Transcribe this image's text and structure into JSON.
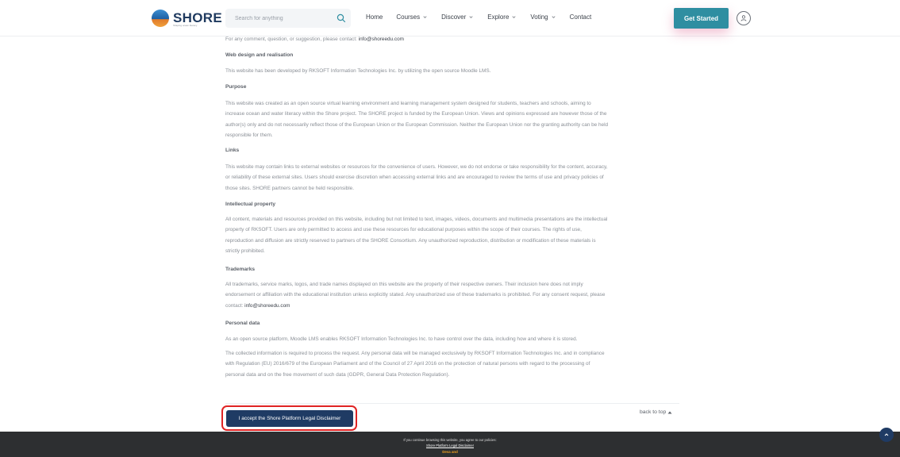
{
  "header": {
    "logo_text": "SHORE",
    "logo_subtitle": "Shaping ocean literacy",
    "search_placeholder": "Search for anything",
    "nav": [
      {
        "label": "Home",
        "has_dropdown": false
      },
      {
        "label": "Courses",
        "has_dropdown": true
      },
      {
        "label": "Discover",
        "has_dropdown": true
      },
      {
        "label": "Explore",
        "has_dropdown": true
      },
      {
        "label": "Voting",
        "has_dropdown": true
      },
      {
        "label": "Contact",
        "has_dropdown": false
      }
    ],
    "get_started_label": "Get Started",
    "accent_color": "#2f8ea1"
  },
  "content": {
    "contact_prefix": "For any comment, question, or suggestion, please contact: ",
    "contact_email": "info@shoreedu.com",
    "web_design_heading": "Web design and realisation",
    "web_design_text": "This website has been developed by RKSOFT Information Technologies Inc. by utilizing the open source Moodle LMS.",
    "purpose_heading": "Purpose",
    "purpose_lines": [
      "This website was created as an open source virtual learning environment and learning management system designed for students, teachers and schools, aiming to",
      "increase ocean and water literacy within the Shore project. The SHORE project is funded by the European Union. Views and opinions expressed are however those of the",
      "author(s) only and do not necessarily reflect those of the European Union or the European Commission. Neither the European Union nor the granting authority can be held",
      "responsible for them."
    ],
    "links_heading": "Links",
    "links_lines": [
      "This website may contain links to external websites or resources for the convenience of users. However, we do not endorse or take responsibility for the content, accuracy,",
      "or reliability of these external sites. Users should exercise discretion when accessing external links and are encouraged to review the terms of use and privacy policies of",
      "those sites. SHORE partners cannot be held responsible."
    ],
    "ip_heading": "Intellectual property",
    "ip_lines": [
      "All content, materials and resources provided on this website, including but not limited to text, images, videos, documents and multimedia presentations are the intellectual",
      "property of RKSOFT. Users are only permitted to access and use these resources for educational purposes within the scope of their courses. The rights of use,",
      "reproduction and diffusion are strictly reserved to partners of the SHORE Consortium.  Any unauthorized reproduction, distribution or modification of these materials is",
      "strictly prohibited."
    ],
    "trademarks_heading": "Trademarks",
    "trademarks_lines": [
      "All trademarks, service marks, logos, and trade names displayed on this website are the property of their respective owners. Their inclusion here does not imply",
      "endorsement or affiliation with the educational institution unless explicitly stated. Any unauthorized use of these trademarks is prohibited. For any consent request, please"
    ],
    "trademarks_contact_prefix": "contact: ",
    "trademarks_email": "info@shoreedu.com",
    "personal_heading": "Personal data",
    "personal_text": "As an open source platform, Moodle LMS enables RKSOFT Information Technologies Inc.  to have control over the data, including how and where it is stored.",
    "collected_lines": [
      "The collected information is required to process the request. Any personal data will be managed exclusively by RKSOFT Information Technologies Inc.  and in compliance",
      "with Regulation (EU) 2016/679 of the European Parliament and of the Council of 27 April 2016 on the protection of natural persons with regard to the processing of",
      "personal data and on the free movement of such data (GDPR, General Data Protection Regulation)."
    ]
  },
  "actions": {
    "accept_label": "I accept the Shore Platform Legal Disclaimer",
    "back_to_top_label": "back to top"
  },
  "footer": {
    "notice": "If you continue browsing this website, you agree to our policies:",
    "policy_link": "Shore Platform Legal Disclaimer",
    "extra": "Deva and"
  }
}
